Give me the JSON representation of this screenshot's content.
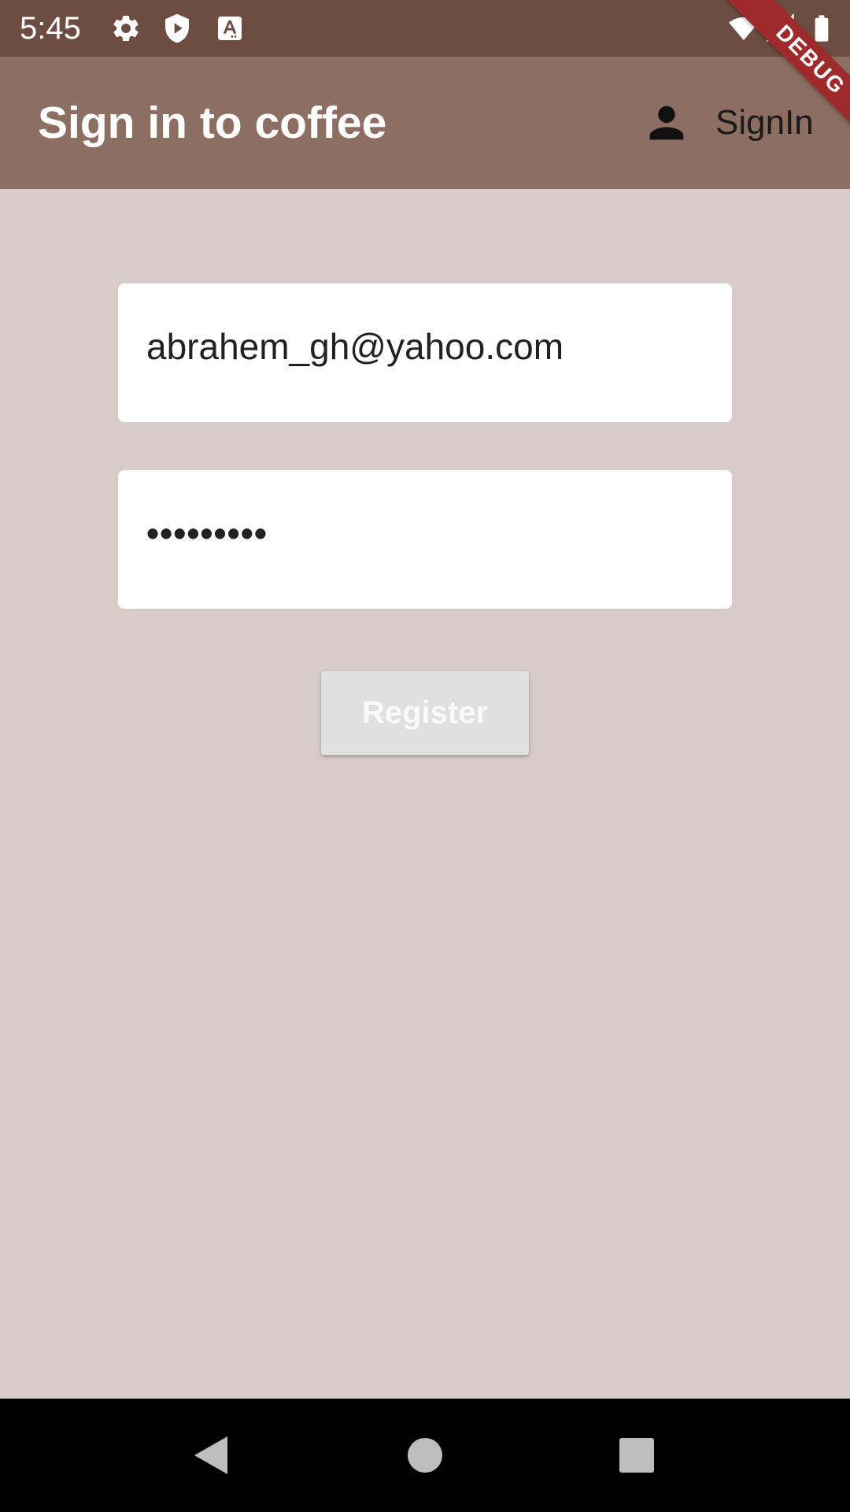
{
  "status_bar": {
    "time": "5:45",
    "left_icons": [
      "gear-icon",
      "shield-play-icon",
      "font-a-icon"
    ],
    "right_icons": [
      "wifi-icon",
      "signal-icon",
      "battery-icon"
    ]
  },
  "app_bar": {
    "title": "Sign in to coffee",
    "action_icon": "person-icon",
    "action_label": "SignIn"
  },
  "debug_banner": {
    "label": "DEBUG"
  },
  "form": {
    "email_value": "abrahem_gh@yahoo.com",
    "password_masked": "•••••••••",
    "register_label": "Register"
  },
  "nav_bar": {
    "buttons": [
      "back-icon",
      "home-icon",
      "recents-icon"
    ]
  },
  "colors": {
    "status_bar": "#6d4c41",
    "app_bar": "#8d6e63",
    "background": "#d7ccc8",
    "field": "#ffffff",
    "button_disabled": "#e0e0e0",
    "debug_ribbon": "#9e2a2b"
  }
}
